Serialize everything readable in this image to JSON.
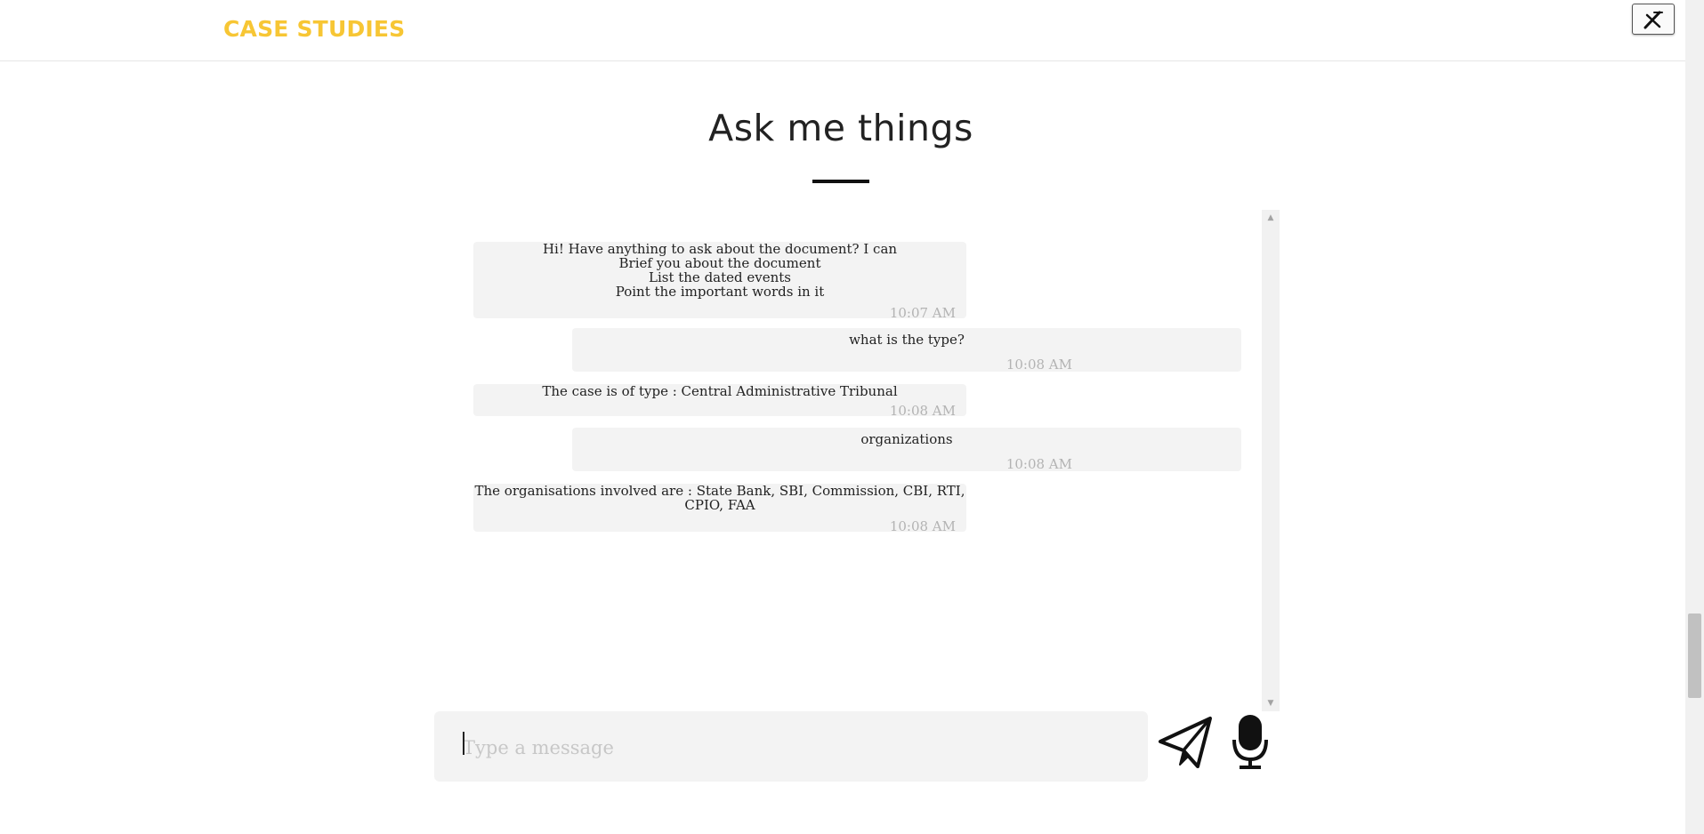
{
  "header": {
    "brand": "CASE STUDIES",
    "close_icon": "close-x-icon"
  },
  "page": {
    "title": "Ask me things"
  },
  "chat": {
    "messages": [
      {
        "sender": "bot",
        "lines": [
          "Hi! Have anything to ask about the document? I can",
          "Brief you about the document",
          "List the dated events",
          "Point the important words in it"
        ],
        "time": "10:07 AM"
      },
      {
        "sender": "user",
        "lines": [
          "what is the type?"
        ],
        "time": "10:08 AM"
      },
      {
        "sender": "bot",
        "lines": [
          "The case is of type : Central Administrative Tribunal"
        ],
        "time": "10:08 AM"
      },
      {
        "sender": "user",
        "lines": [
          "organizations"
        ],
        "time": "10:08 AM"
      },
      {
        "sender": "bot",
        "lines": [
          "The organisations involved are : State Bank, SBI, Commission, CBI, RTI,",
          "CPIO, FAA"
        ],
        "time": "10:08 AM"
      }
    ]
  },
  "composer": {
    "placeholder": "Type a message",
    "value": "",
    "send_icon": "paper-plane-icon",
    "mic_icon": "microphone-icon"
  },
  "colors": {
    "brand": "#f7c634",
    "bubble": "#f3f3f3",
    "timestamp": "#b3b3b3"
  }
}
